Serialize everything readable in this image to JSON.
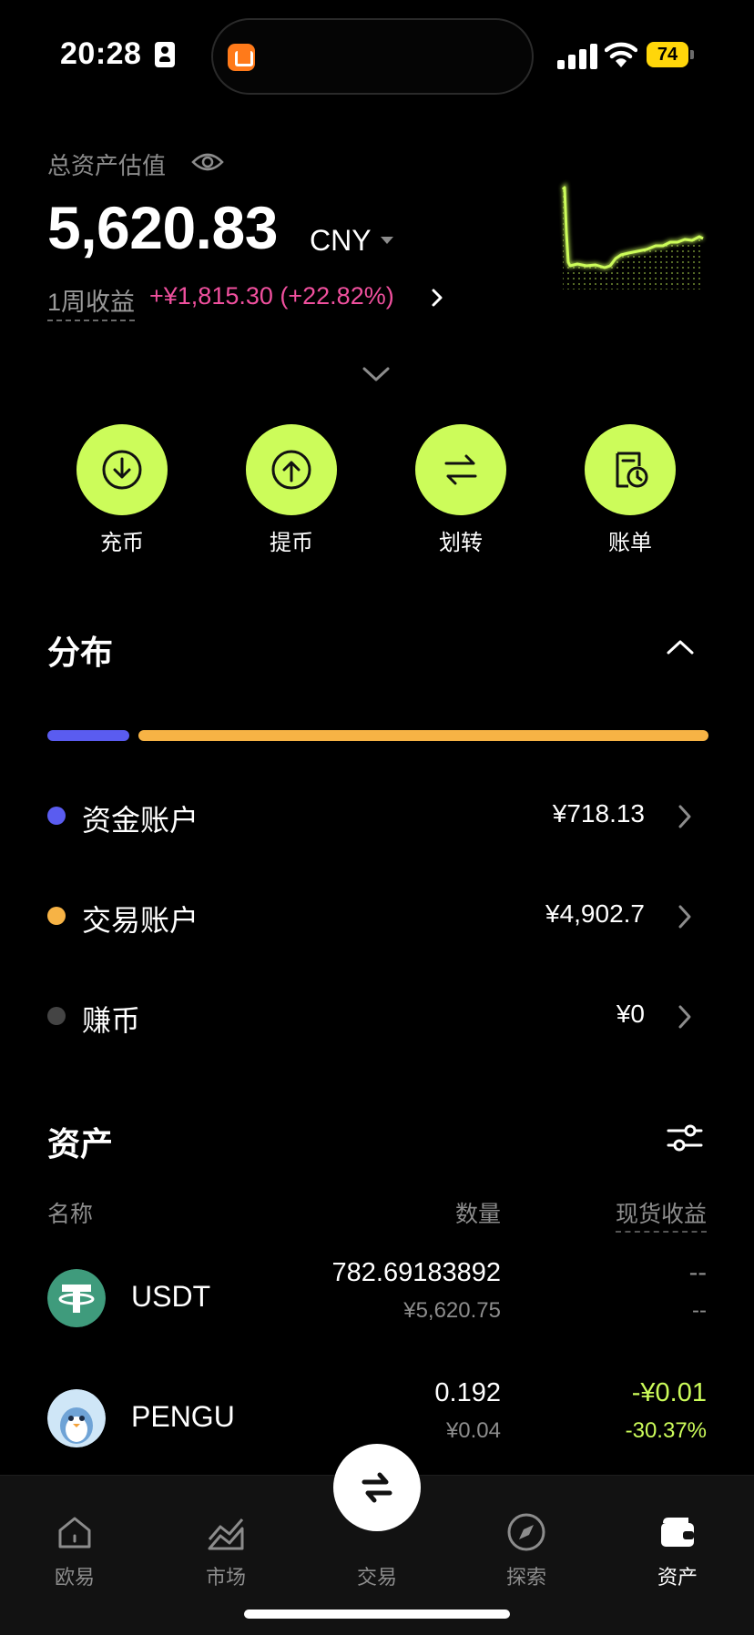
{
  "status_bar": {
    "time": "20:28",
    "battery": "74"
  },
  "header": {
    "total_label": "总资产估值",
    "total_value": "5,620.83",
    "currency": "CNY",
    "week_label": "1周收益",
    "week_value": "+¥1,815.30 (+22.82%)"
  },
  "actions": [
    {
      "label": "充币",
      "icon": "deposit-icon"
    },
    {
      "label": "提币",
      "icon": "withdraw-icon"
    },
    {
      "label": "划转",
      "icon": "transfer-icon"
    },
    {
      "label": "账单",
      "icon": "bill-icon"
    }
  ],
  "distribution": {
    "title": "分布",
    "accounts": [
      {
        "name": "资金账户",
        "value": "¥718.13",
        "color": "#5a5cf0"
      },
      {
        "name": "交易账户",
        "value": "¥4,902.7",
        "color": "#f7b345"
      },
      {
        "name": "赚币",
        "value": "¥0",
        "color": "#444444"
      }
    ]
  },
  "assets": {
    "title": "资产",
    "columns": {
      "name": "名称",
      "quantity": "数量",
      "pnl": "现货收益"
    },
    "rows": [
      {
        "symbol": "USDT",
        "quantity": "782.69183892",
        "value_cny": "¥5,620.75",
        "pnl": "--",
        "pnl_pct": "--"
      },
      {
        "symbol": "PENGU",
        "quantity": "0.192",
        "value_cny": "¥0.04",
        "pnl": "-¥0.01",
        "pnl_pct": "-30.37%"
      }
    ]
  },
  "tabs": [
    {
      "label": "欧易",
      "icon": "home-icon"
    },
    {
      "label": "市场",
      "icon": "market-icon"
    },
    {
      "label": "交易",
      "icon": "trade-swap-icon"
    },
    {
      "label": "探索",
      "icon": "compass-icon"
    },
    {
      "label": "资产",
      "icon": "wallet-icon",
      "active": true
    }
  ],
  "colors": {
    "accent": "#ccfc5a",
    "profit_pink": "#f0509e",
    "pnl_green": "#ccfc5a"
  }
}
